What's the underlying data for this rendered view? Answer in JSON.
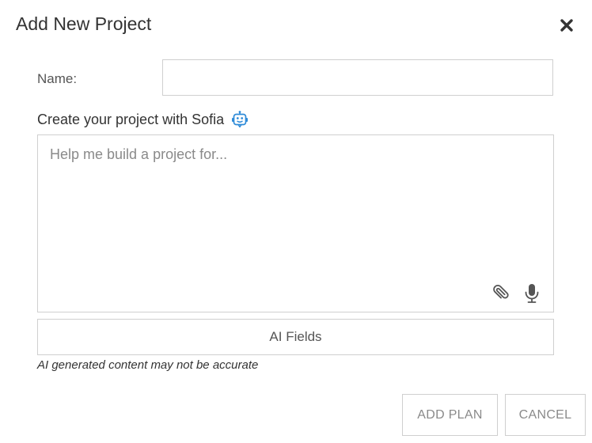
{
  "dialog": {
    "title": "Add New Project",
    "close_icon": "close-x-icon"
  },
  "form": {
    "name_label": "Name:",
    "name_value": "",
    "sofia_label": "Create your project with Sofia",
    "sofia_icon": "robot-icon",
    "prompt_placeholder": "Help me build a project for...",
    "prompt_value": "",
    "attach_icon": "paperclip-icon",
    "mic_icon": "microphone-icon",
    "ai_fields_label": "AI Fields",
    "disclaimer": "AI generated content may not be accurate"
  },
  "buttons": {
    "add_plan": "ADD PLAN",
    "cancel": "CANCEL"
  },
  "colors": {
    "accent": "#2f8bd8",
    "border": "#cfcfcf",
    "muted_text": "#8a8a8a"
  }
}
